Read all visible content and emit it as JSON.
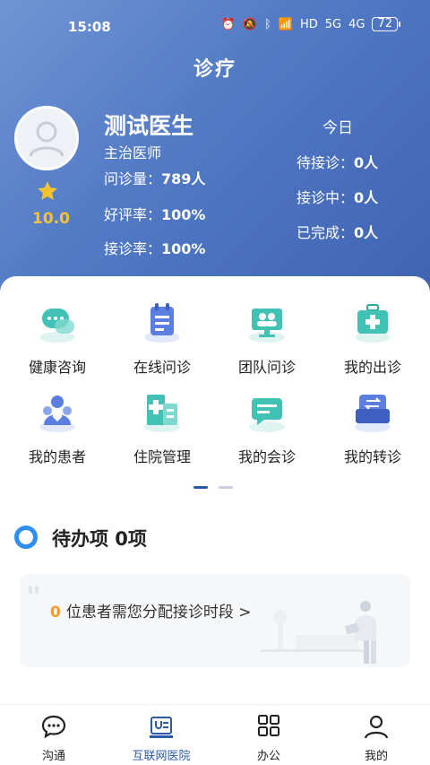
{
  "status_bar": {
    "time": "15:08",
    "network": "HD",
    "signal_1": "5G",
    "signal_2": "4G",
    "battery": "72"
  },
  "page_title": "诊疗",
  "doctor": {
    "name": "测试医生",
    "title": "主治医师",
    "score": "10.0",
    "stats": [
      {
        "label": "问诊量：",
        "value": "789人"
      },
      {
        "label": "好评率：",
        "value": "100%"
      },
      {
        "label": "接诊率：",
        "value": "100%"
      }
    ]
  },
  "today": {
    "title": "今日",
    "rows": [
      {
        "label": "待接诊：",
        "value": "0人"
      },
      {
        "label": "接诊中：",
        "value": "0人"
      },
      {
        "label": "已完成：",
        "value": "0人"
      }
    ]
  },
  "menu": [
    {
      "label": "健康咨询",
      "icon": "chat-bubbles-icon"
    },
    {
      "label": "在线问诊",
      "icon": "clipboard-icon"
    },
    {
      "label": "团队问诊",
      "icon": "team-monitor-icon"
    },
    {
      "label": "我的出诊",
      "icon": "medical-kit-icon"
    },
    {
      "label": "我的患者",
      "icon": "patients-icon"
    },
    {
      "label": "住院管理",
      "icon": "hospital-building-icon"
    },
    {
      "label": "我的会诊",
      "icon": "consultation-icon"
    },
    {
      "label": "我的转诊",
      "icon": "referral-icon"
    }
  ],
  "todo": {
    "title": "待办项 0项",
    "count": "0",
    "message": "位患者需您分配接诊时段 >"
  },
  "tabs": [
    {
      "label": "沟通",
      "icon": "chat-icon"
    },
    {
      "label": "互联网医院",
      "icon": "stethoscope-board-icon",
      "active": true
    },
    {
      "label": "办公",
      "icon": "grid-icon"
    },
    {
      "label": "我的",
      "icon": "person-icon"
    }
  ],
  "colors": {
    "header_start": "#6f95d4",
    "header_end": "#3f63b2",
    "accent": "#2d5aa8",
    "score": "#f4c430",
    "todo_number": "#f59a23"
  }
}
